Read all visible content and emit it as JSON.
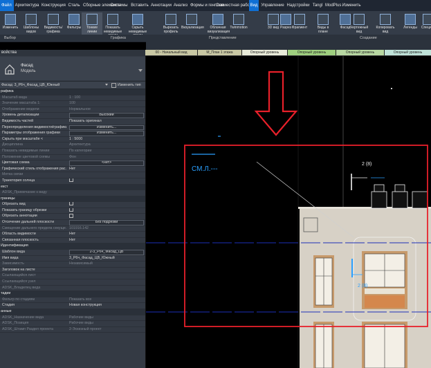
{
  "menubar": {
    "file": "Файл",
    "items": [
      "Архитектура",
      "Конструкция",
      "Сталь",
      "Сборные элементы",
      "Системы",
      "Вставить",
      "Аннотации",
      "Анализ",
      "Формы и генплан",
      "Совместная работа",
      "Вид",
      "Управление",
      "Надстройки",
      "Tangl",
      "ModPlus",
      "Изменить"
    ],
    "active": "Вид"
  },
  "ribbon": {
    "buttons": [
      {
        "label": "Изменить",
        "id": "modify"
      },
      {
        "label": "Шаблоны видов",
        "id": "view-templates"
      },
      {
        "label": "Видимость/ графика",
        "id": "visibility-graphics"
      },
      {
        "label": "Фильтры",
        "id": "filters"
      },
      {
        "label": "Тонкие линии",
        "id": "thin-lines"
      },
      {
        "label": "Показать невидимые линии",
        "id": "show-hidden"
      },
      {
        "label": "Скрыть невидимые линии",
        "id": "hide-hidden"
      },
      {
        "label": "Вырезать профиль",
        "id": "cut-profile"
      },
      {
        "label": "Визуализация",
        "id": "render"
      },
      {
        "label": "Облачная визуализация",
        "id": "cloud-render"
      },
      {
        "label": "Twinmotion",
        "id": "twinmotion"
      },
      {
        "label": "3D вид",
        "id": "3d-view"
      },
      {
        "label": "Разрез",
        "id": "section"
      },
      {
        "label": "Фрагмент",
        "id": "callout"
      },
      {
        "label": "Виды в плане",
        "id": "plan-views"
      },
      {
        "label": "Фасад",
        "id": "elevation"
      },
      {
        "label": "Чертежный вид",
        "id": "drafting-view"
      },
      {
        "label": "Копировать вид",
        "id": "duplicate-view"
      },
      {
        "label": "Легенды",
        "id": "legends"
      },
      {
        "label": "Специф.",
        "id": "schedules"
      }
    ],
    "groups": {
      "select": "Выбор",
      "graphics": "Графика",
      "presentation": "Представление",
      "create": "Создание"
    }
  },
  "view_tabs": [
    "00 - Начальный вид",
    "М_План 1 этажа",
    "Опорный уровень",
    "Опорный уровень",
    "Опорный уровень",
    "Опорный уровень"
  ],
  "properties": {
    "title": "войства",
    "type_name": "Фасад",
    "type_sub": "Модель",
    "instance": "Фасад: 3_Р6ч_Фасад_ЦВ_Южный",
    "edit_type": "Изменить тип",
    "rows": [
      {
        "k": "рафика",
        "head": true
      },
      {
        "k": "Масштаб вида",
        "v": "1 : 100",
        "dim": true
      },
      {
        "k": "Значение масштаба   1:",
        "v": "100",
        "dim": true
      },
      {
        "k": "Отображение модели",
        "v": "Нормальное",
        "dim": true
      },
      {
        "k": "Уровень детализации",
        "v": "Высокий",
        "box": true
      },
      {
        "k": "Видимость частей",
        "v": "Показать оригинал"
      },
      {
        "k": "Переопределения видимости/графики",
        "v": "Изменить...",
        "box": true
      },
      {
        "k": "Параметры отображения графики",
        "v": "Изменить...",
        "box": true
      },
      {
        "k": "Скрыть при масштабе <",
        "v": "1 : 5000"
      },
      {
        "k": "Дисциплина",
        "v": "Архитектура",
        "dim": true
      },
      {
        "k": "Показать невидимые линии",
        "v": "По категории",
        "dim": true
      },
      {
        "k": "Положение цветовой схемы",
        "v": "Фон",
        "dim": true
      },
      {
        "k": "Цветовая схема",
        "v": "<нет>",
        "box": true
      },
      {
        "k": "Графический стиль отображения рас...",
        "v": "Нет"
      },
      {
        "k": "Метка связи",
        "v": "",
        "dim": true
      },
      {
        "k": "Траектория солнца",
        "v": "",
        "chk": true
      },
      {
        "k": "екст",
        "head": true
      },
      {
        "k": "ADSK_Примечание к виду",
        "v": "",
        "dim": true
      },
      {
        "k": "границы",
        "head": true
      },
      {
        "k": "Обрезать вид",
        "v": "",
        "chk": true
      },
      {
        "k": "Показать границу обрезки",
        "v": "",
        "chk": true
      },
      {
        "k": "Обрезать аннотации",
        "v": "",
        "chk": true
      },
      {
        "k": "Отсечение дальней плоскости",
        "v": "Без подрезки",
        "box": true
      },
      {
        "k": "Смещение дальнего предела секуще...",
        "v": "101916.142",
        "dim": true
      },
      {
        "k": "Область видимости",
        "v": "Нет"
      },
      {
        "k": "Связанная плоскость",
        "v": "Нет"
      },
      {
        "k": "Идентификация",
        "head": true
      },
      {
        "k": "Шаблон вида",
        "v": "2-3_Р6ч_Фасад_ЦВ",
        "box": true
      },
      {
        "k": "Имя вида",
        "v": "3_Р6ч_Фасад_ЦВ_Южный"
      },
      {
        "k": "Зависимость",
        "v": "Независимый",
        "dim": true
      },
      {
        "k": "Заголовок на листе",
        "v": ""
      },
      {
        "k": "Ссылающийся лист",
        "v": "",
        "dim": true
      },
      {
        "k": "Ссылающийся узел",
        "v": "",
        "dim": true
      },
      {
        "k": "ADSK_Владелец вида",
        "v": "",
        "dim": true
      },
      {
        "k": "тадии",
        "head": true
      },
      {
        "k": "Фильтр по стадиям",
        "v": "Показать все",
        "dim": true
      },
      {
        "k": "Стадия",
        "v": "Новая конструкция"
      },
      {
        "k": "анные",
        "head": true
      },
      {
        "k": "ADSK_Назначение вида",
        "v": "Рабочие виды",
        "dim": true
      },
      {
        "k": "ADSK_Позиция",
        "v": "Рабочие виды",
        "dim": true
      },
      {
        "k": "ADSK_Штамп Раздел проекта",
        "v": "2-Эскизный проект",
        "dim": true
      }
    ]
  },
  "canvas": {
    "level_text": "СМ.Л.---",
    "section_tag_top": "2 (8)",
    "section_tag_bottom": "2 (8)"
  },
  "colors": {
    "accent": "#0f6fd4",
    "annotation_red": "#e8202a",
    "annotation_blue": "#2aa0ff",
    "wall": "#d7d1c6"
  }
}
